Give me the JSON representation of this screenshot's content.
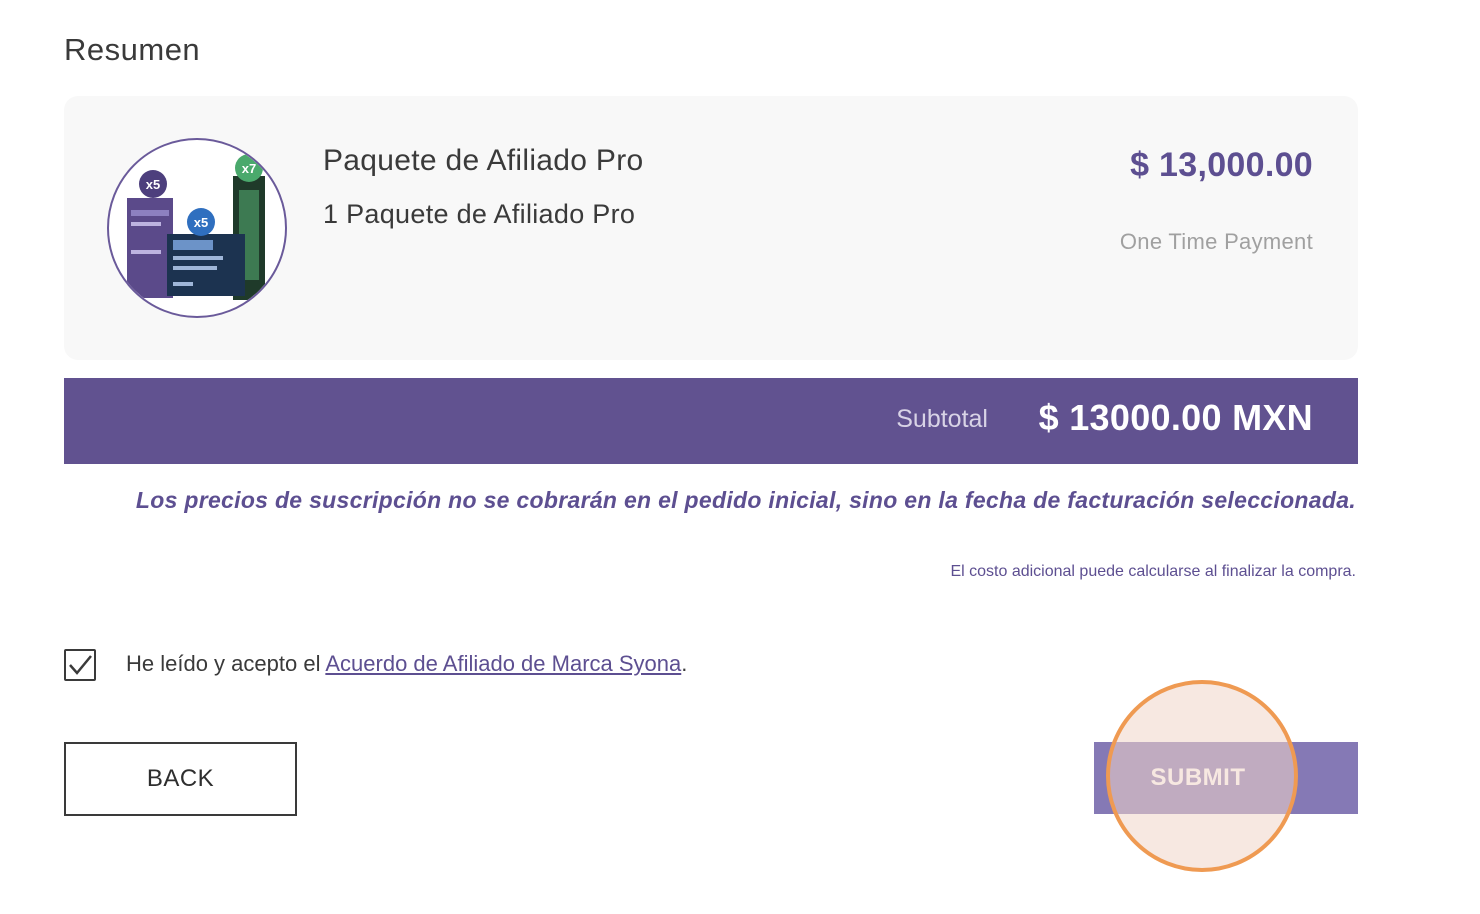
{
  "summary": {
    "title": "Resumen",
    "item": {
      "name": "Paquete de Afiliado Pro",
      "description": "1 Paquete de Afiliado Pro",
      "price": "$ 13,000.00",
      "payment_type": "One Time Payment",
      "image_badges": [
        "x5",
        "x5",
        "x7"
      ]
    },
    "subtotal_label": "Subtotal",
    "subtotal_value": "$ 13000.00 MXN",
    "subscription_note": "Los precios de suscripción no se cobrarán en el pedido inicial, sino en la fecha de facturación seleccionada.",
    "extra_cost_note": "El costo adicional puede calcularse al finalizar la compra."
  },
  "agreement": {
    "checked": true,
    "prefix": "He leído y acepto el ",
    "link_text": "Acuerdo de Afiliado de Marca Syona",
    "suffix": "."
  },
  "actions": {
    "back_label": "BACK",
    "submit_label": "SUBMIT"
  },
  "colors": {
    "brand_purple": "#615290",
    "accent_purple": "#5d4f91",
    "submit_bg": "#8579b5",
    "click_indicator": "#ef9a52"
  }
}
